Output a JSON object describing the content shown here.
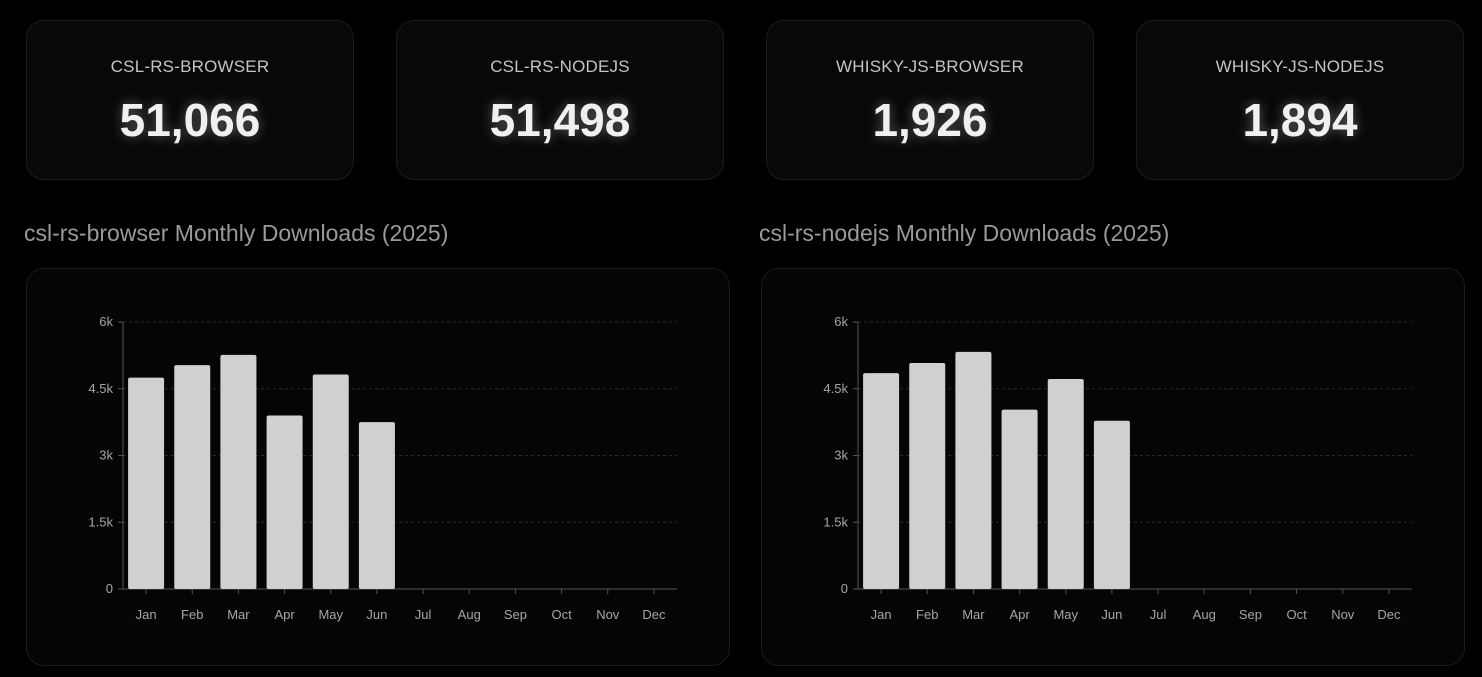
{
  "stats": [
    {
      "label": "CSL-RS-BROWSER",
      "value": "51,066"
    },
    {
      "label": "CSL-RS-NODEJS",
      "value": "51,498"
    },
    {
      "label": "WHISKY-JS-BROWSER",
      "value": "1,926"
    },
    {
      "label": "WHISKY-JS-NODEJS",
      "value": "1,894"
    }
  ],
  "colors": {
    "bar_fill": "#d0d0d0",
    "axis": "#555555",
    "grid": "#2a2a2a",
    "tick_text": "#a6a6a6"
  },
  "chart_data": [
    {
      "type": "bar",
      "title": "csl-rs-browser Monthly Downloads (2025)",
      "categories": [
        "Jan",
        "Feb",
        "Mar",
        "Apr",
        "May",
        "Jun",
        "Jul",
        "Aug",
        "Sep",
        "Oct",
        "Nov",
        "Dec"
      ],
      "values": [
        4750,
        5030,
        5260,
        3900,
        4820,
        3750,
        0,
        0,
        0,
        0,
        0,
        0
      ],
      "ylim": [
        0,
        6000
      ],
      "yticks": [
        0,
        1500,
        3000,
        4500,
        6000
      ],
      "ytick_labels": [
        "0",
        "1.5k",
        "3k",
        "4.5k",
        "6k"
      ],
      "grid": true,
      "legend": "none"
    },
    {
      "type": "bar",
      "title": "csl-rs-nodejs Monthly Downloads (2025)",
      "categories": [
        "Jan",
        "Feb",
        "Mar",
        "Apr",
        "May",
        "Jun",
        "Jul",
        "Aug",
        "Sep",
        "Oct",
        "Nov",
        "Dec"
      ],
      "values": [
        4850,
        5080,
        5330,
        4030,
        4720,
        3780,
        0,
        0,
        0,
        0,
        0,
        0
      ],
      "ylim": [
        0,
        6000
      ],
      "yticks": [
        0,
        1500,
        3000,
        4500,
        6000
      ],
      "ytick_labels": [
        "0",
        "1.5k",
        "3k",
        "4.5k",
        "6k"
      ],
      "grid": true,
      "legend": "none"
    }
  ]
}
